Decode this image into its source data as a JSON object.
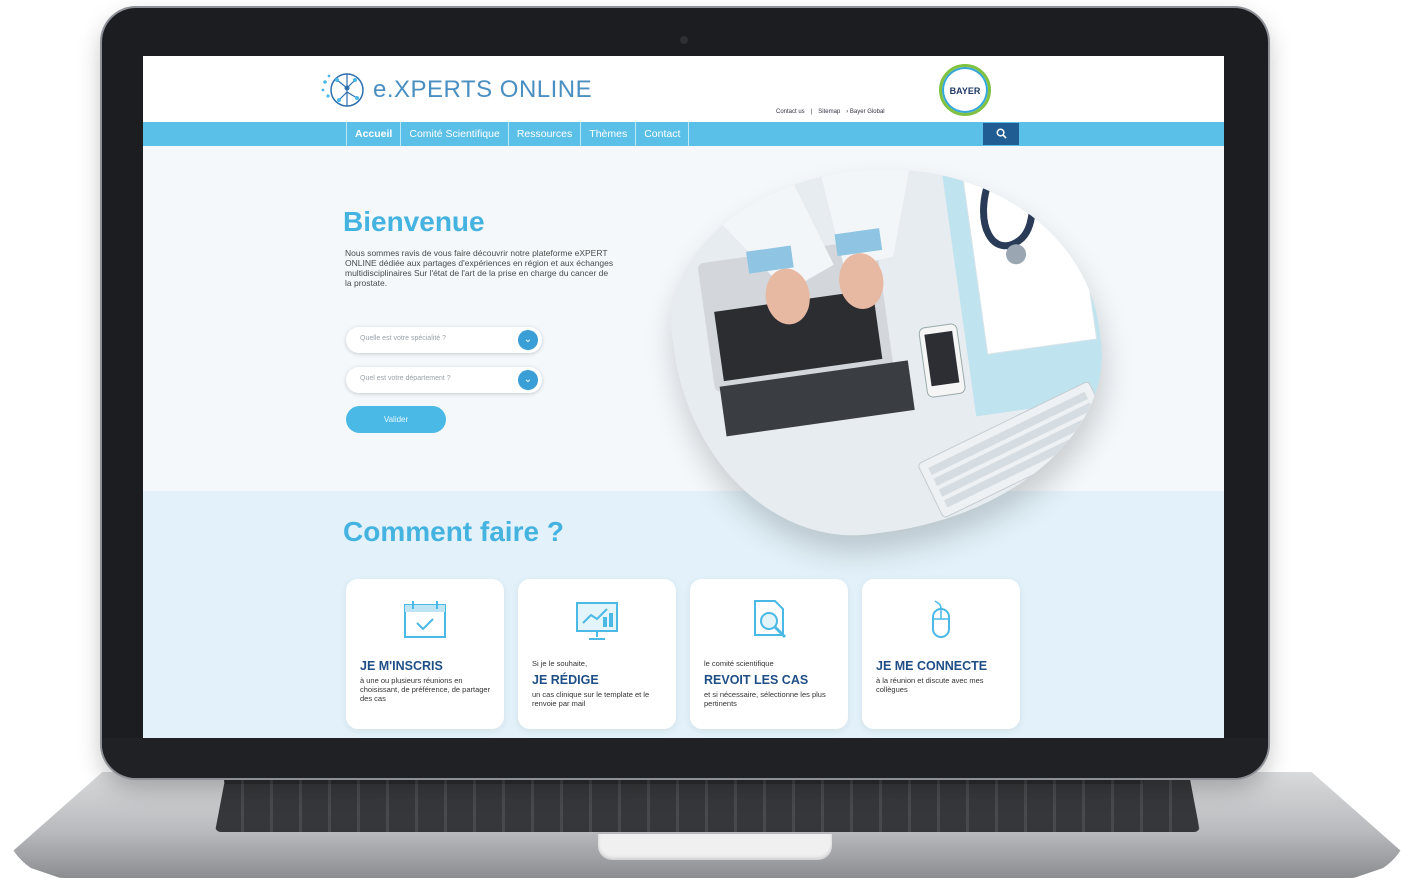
{
  "brand": {
    "name": "e.XPERTS ONLINE",
    "partner_logo_text": "BAYER"
  },
  "toplinks": [
    "Contact us",
    "|",
    "Sitemap",
    "› Bayer Global"
  ],
  "nav": {
    "items": [
      {
        "label": "Accueil"
      },
      {
        "label": "Comité Scientifique"
      },
      {
        "label": "Ressources"
      },
      {
        "label": "Thèmes"
      },
      {
        "label": "Contact"
      }
    ],
    "search_icon": "search-icon"
  },
  "welcome": {
    "title": "Bienvenue",
    "text": "Nous sommes ravis de vous faire découvrir notre plateforme eXPERT ONLINE dédiée aux partages d'expériences en région et aux échanges multidisciplinaires Sur l'état de l'art de la prise en charge du cancer de la prostate."
  },
  "form": {
    "specialty_placeholder": "Quelle est votre spécialité ?",
    "department_placeholder": "Quel est votre département ?",
    "validate_label": "Valider"
  },
  "how": {
    "title": "Comment faire ?",
    "cards": [
      {
        "icon": "calendar-check-icon",
        "pre": "",
        "title": "JE M'INSCRIS",
        "desc": "à une ou plusieurs réunions en choisissant, de préférence, de partager des cas"
      },
      {
        "icon": "presentation-board-icon",
        "pre": "Si je le souhaite,",
        "title": "JE RÉDIGE",
        "desc": "un cas clinique sur le template et le renvoie par mail"
      },
      {
        "icon": "document-search-icon",
        "pre": "le comité scientifique",
        "title": "REVOIT LES CAS",
        "desc": "et si nécessaire, sélectionne les plus pertinents"
      },
      {
        "icon": "mouse-icon",
        "pre": "",
        "title": "JE ME CONNECTE",
        "desc": "à la réunion et discute avec mes collègues"
      }
    ]
  },
  "colors": {
    "accent": "#45b3e0",
    "nav": "#5bc0e8",
    "dark_blue": "#1f5d93",
    "title_blue": "#1f4e86"
  }
}
